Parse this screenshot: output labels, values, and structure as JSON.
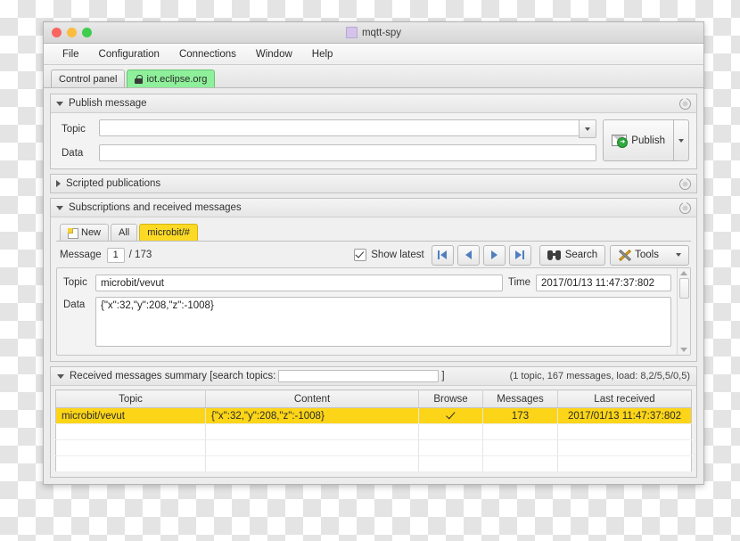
{
  "window": {
    "title": "mqtt-spy",
    "title_icon": "app-icon",
    "traffic_lights": [
      "close",
      "minimize",
      "zoom"
    ]
  },
  "menubar": {
    "items": [
      "File",
      "Configuration",
      "Connections",
      "Window",
      "Help"
    ]
  },
  "connection_tabs": [
    {
      "label": "Control panel",
      "active": false,
      "locked": false
    },
    {
      "label": "iot.eclipse.org",
      "active": true,
      "locked": true
    }
  ],
  "publish": {
    "section_title": "Publish message",
    "topic_label": "Topic",
    "topic_value": "",
    "topic_placeholder": "",
    "data_label": "Data",
    "data_value": "",
    "data_placeholder": "",
    "publish_button": "Publish",
    "dropdown_icon": "chevron-down-icon",
    "settings_icon": "settings-icon"
  },
  "scripted": {
    "section_title": "Scripted publications",
    "settings_icon": "settings-icon"
  },
  "subscriptions": {
    "section_title": "Subscriptions and received messages",
    "settings_icon": "settings-icon",
    "tabs": [
      {
        "label": "New",
        "active": false,
        "icon": "new-page-icon"
      },
      {
        "label": "All",
        "active": false
      },
      {
        "label": "microbit/#",
        "active": true
      }
    ],
    "toolbar": {
      "message_label": "Message",
      "message_index": "1",
      "message_total": "/ 173",
      "show_latest_label": "Show latest",
      "show_latest_checked": true,
      "nav_first": "first-message-button",
      "nav_prev": "previous-message-button",
      "nav_next": "next-message-button",
      "nav_last": "last-message-button",
      "search_label": "Search",
      "tools_label": "Tools"
    },
    "detail": {
      "topic_label": "Topic",
      "topic_value": "microbit/vevut",
      "time_label": "Time",
      "time_value": "2017/01/13 11:47:37:802",
      "data_label": "Data",
      "data_value": "{\"x\":32,\"y\":208,\"z\":-1008}"
    }
  },
  "summary": {
    "title_prefix": "Received messages summary [search topics:",
    "title_suffix": "]",
    "search_value": "",
    "search_placeholder": "",
    "stats": "(1 topic, 167 messages, load: 8,2/5,5/0,5)",
    "columns": [
      "Topic",
      "Content",
      "Browse",
      "Messages",
      "Last received"
    ],
    "rows": [
      {
        "topic": "microbit/vevut",
        "content": "{\"x\":32,\"y\":208,\"z\":-1008}",
        "browse": true,
        "messages": "173",
        "last_received": "2017/01/13 11:47:37:802",
        "selected": true
      }
    ],
    "empty_rows": 3
  },
  "colors": {
    "selected_row": "#fcd518",
    "active_sub_tab": "#fcd925",
    "active_conn_tab": "#8ef09a",
    "nav_arrow": "#4f7fbf"
  }
}
